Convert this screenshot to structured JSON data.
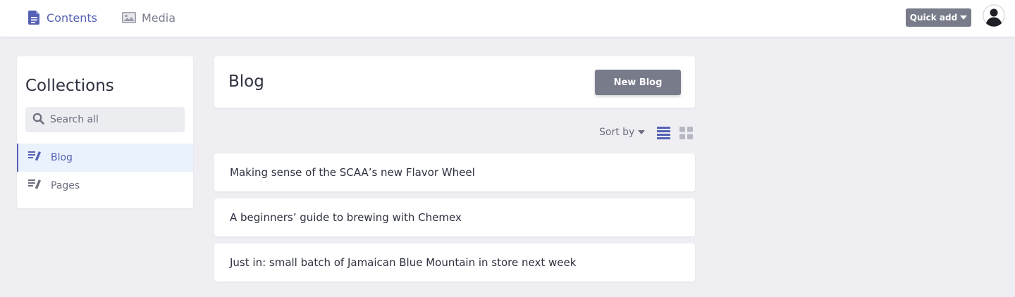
{
  "topbar": {
    "tabs": [
      {
        "label": "Contents",
        "icon": "document-icon",
        "active": true
      },
      {
        "label": "Media",
        "icon": "image-icon",
        "active": false
      }
    ],
    "quick_add_label": "Quick add",
    "avatar_icon": "user-avatar-icon"
  },
  "sidebar": {
    "title": "Collections",
    "search_placeholder": "Search all",
    "items": [
      {
        "label": "Blog",
        "icon": "edit-list-icon",
        "active": true
      },
      {
        "label": "Pages",
        "icon": "edit-list-icon",
        "active": false
      }
    ]
  },
  "main": {
    "title": "Blog",
    "new_button_label": "New Blog",
    "sort_label": "Sort by",
    "view_modes": [
      "list",
      "grid"
    ],
    "active_view": "list",
    "entries": [
      {
        "title": "Making sense of the SCAA’s new Flavor Wheel"
      },
      {
        "title": "A beginners’ guide to brewing with Chemex"
      },
      {
        "title": "Just in: small batch of Jamaican Blue Mountain in store next week"
      }
    ]
  },
  "colors": {
    "accent": "#5561b5",
    "button_gray": "#787b8a",
    "background": "#efeff3",
    "active_item_bg": "#eaf2fd"
  }
}
